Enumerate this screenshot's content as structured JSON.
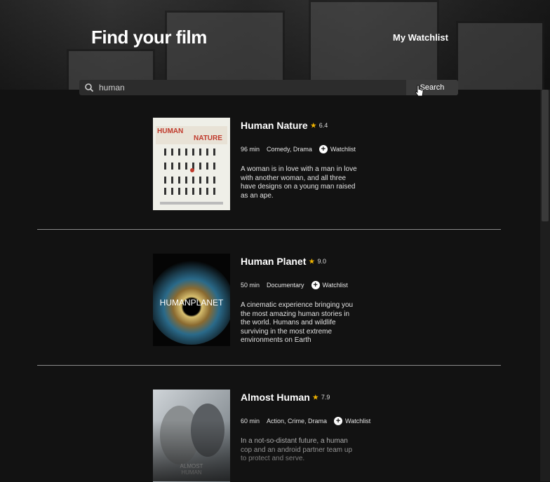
{
  "header": {
    "title": "Find your film",
    "watchlist_link": "My Watchlist"
  },
  "search": {
    "value": "human",
    "button_label": "Search"
  },
  "movies": [
    {
      "title": "Human Nature",
      "rating": "6.4",
      "duration": "96 min",
      "genres": "Comedy, Drama",
      "watchlist_label": "Watchlist",
      "description": "A woman is in love with a man in love with another woman, and all three have designs on a young man raised as an ape.",
      "poster_title": "HUMAN NATURE"
    },
    {
      "title": "Human Planet",
      "rating": "9.0",
      "duration": "50 min",
      "genres": "Documentary",
      "watchlist_label": "Watchlist",
      "description": "A cinematic experience bringing you the most amazing human stories in the world. Humans and wildlife surviving in the most extreme environments on Earth",
      "poster_title": "HUMANPLANET"
    },
    {
      "title": "Almost Human",
      "rating": "7.9",
      "duration": "60 min",
      "genres": "Action, Crime, Drama",
      "watchlist_label": "Watchlist",
      "description": "In a not-so-distant future, a human cop and an android partner team up to protect and serve.",
      "poster_title": "ALMOST HUMAN"
    }
  ],
  "colors": {
    "background": "#121212",
    "star": "#f0b400",
    "divider": "#8a8a8a"
  }
}
